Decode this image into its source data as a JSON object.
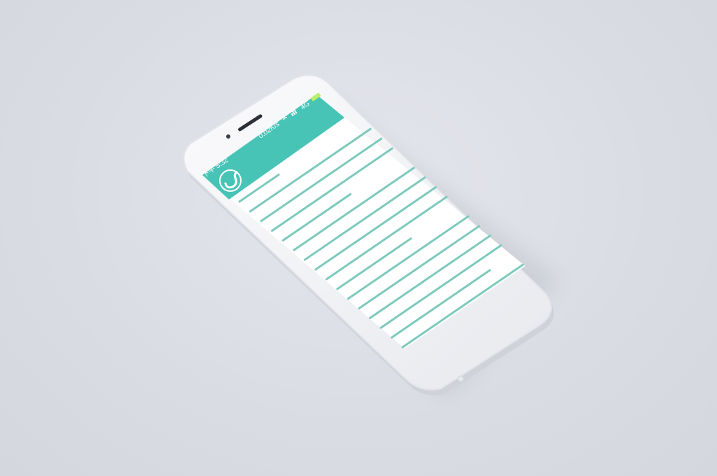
{
  "device": "smartphone",
  "status_bar": {
    "time": "下午 5:32",
    "network_speed": "0.02K/s",
    "network_type": "4G",
    "signal_icon": "signal-icon",
    "wifi_icon": "wifi-icon",
    "battery_icon": "battery-icon"
  },
  "header": {
    "logo_icon": "stomach-logo-icon"
  },
  "content": {
    "line_count": 16
  },
  "colors": {
    "accent": "#48c4b7",
    "line": "#7cc9bd",
    "screen_bg": "#ffffff",
    "phone_body": "#f4f5f7"
  }
}
